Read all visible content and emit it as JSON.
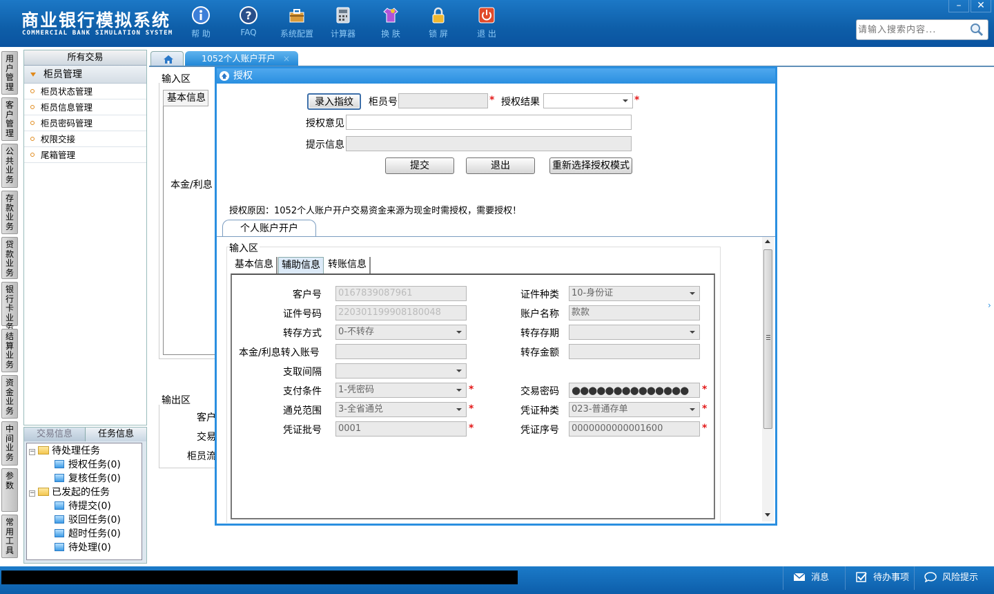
{
  "header": {
    "title": "商业银行模拟系统",
    "subtitle": "COMMERCIAL BANK SIMULATION SYSTEM",
    "toolbar": [
      {
        "label": "帮 助",
        "icon": "info-icon"
      },
      {
        "label": "FAQ",
        "icon": "question-icon"
      },
      {
        "label": "系统配置",
        "icon": "toolbox-icon"
      },
      {
        "label": "计算器",
        "icon": "calculator-icon"
      },
      {
        "label": "换 肤",
        "icon": "shirt-icon"
      },
      {
        "label": "锁 屏",
        "icon": "lock-icon"
      },
      {
        "label": "退 出",
        "icon": "power-icon"
      }
    ],
    "search_placeholder": "请输入搜索内容...",
    "window_min": "–",
    "window_close": "✕"
  },
  "vnav": [
    "用户管理",
    "客户管理",
    "公共业务",
    "存款业务",
    "贷款业务",
    "银行卡业务",
    "结算业务",
    "资金业务",
    "中间业务",
    "参数",
    "常用工具"
  ],
  "left_menu": {
    "header": "所有交易",
    "group": "柜员管理",
    "items": [
      "柜员状态管理",
      "柜员信息管理",
      "柜员密码管理",
      "权限交接",
      "尾箱管理"
    ]
  },
  "task_panel": {
    "tab_trans": "交易信息",
    "tab_task": "任务信息",
    "pending": "待处理任务",
    "pending_children": [
      "授权任务(0)",
      "复核任务(0)"
    ],
    "initiated": "已发起的任务",
    "initiated_children": [
      "待提交(0)",
      "驳回任务(0)",
      "超时任务(0)",
      "待处理(0)"
    ],
    "collapse_sym": "−"
  },
  "tabs": {
    "active": "1052个人账户开户",
    "close": "×"
  },
  "background_form": {
    "input_legend": "输入区",
    "basic_tab": "基本信息",
    "principal_label": "本金/利息",
    "output_legend": "输出区",
    "out_labels": [
      "客户",
      "交易",
      "柜员流"
    ]
  },
  "dialog": {
    "title": "授权",
    "record_btn": "录入指纹",
    "teller_no_label": "柜员号",
    "auth_result_label": "授权结果",
    "auth_opinion_label": "授权意见",
    "hint_label": "提示信息",
    "submit_btn": "提交",
    "exit_btn": "退出",
    "reselect_btn": "重新选择授权模式",
    "auth_reason": "授权原因：1052个人账户开户交易资金来源为现金时需授权，需要授权！",
    "inner_tab": "个人账户开户",
    "inner_legend": "输入区",
    "inner_tabs": [
      "基本信息",
      "辅助信息",
      "转账信息"
    ],
    "required_mark": "*",
    "form": {
      "customer_no_label": "客户号",
      "customer_no": "0167839087961",
      "id_type_label": "证件种类",
      "id_type": "10-身份证",
      "id_no_label": "证件号码",
      "id_no": "220301199908180048",
      "account_name_label": "账户名称",
      "account_name": "款款",
      "transfer_mode_label": "转存方式",
      "transfer_mode": "0-不转存",
      "transfer_period_label": "转存存期",
      "transfer_period": "",
      "principal_account_label": "本金/利息转入账号",
      "principal_account": "",
      "transfer_amount_label": "转存金额",
      "transfer_amount": "",
      "withdraw_interval_label": "支取间隔",
      "withdraw_interval": "",
      "pay_condition_label": "支付条件",
      "pay_condition": "1-凭密码",
      "trade_password_label": "交易密码",
      "trade_password": "●●●●●●●●●●●●●●",
      "exchange_range_label": "通兑范围",
      "exchange_range": "3-全省通兑",
      "voucher_type_label": "凭证种类",
      "voucher_type": "023-普通存单",
      "voucher_batch_label": "凭证批号",
      "voucher_batch": "0001",
      "voucher_serial_label": "凭证序号",
      "voucher_serial": "0000000000001600"
    }
  },
  "statusbar": {
    "message": "消息",
    "todo": "待办事项",
    "risk": "风险提示"
  },
  "colors": {
    "header_blue": "#1c78c6",
    "dialog_border": "#2a8fe0",
    "required_red": "#e31818"
  }
}
